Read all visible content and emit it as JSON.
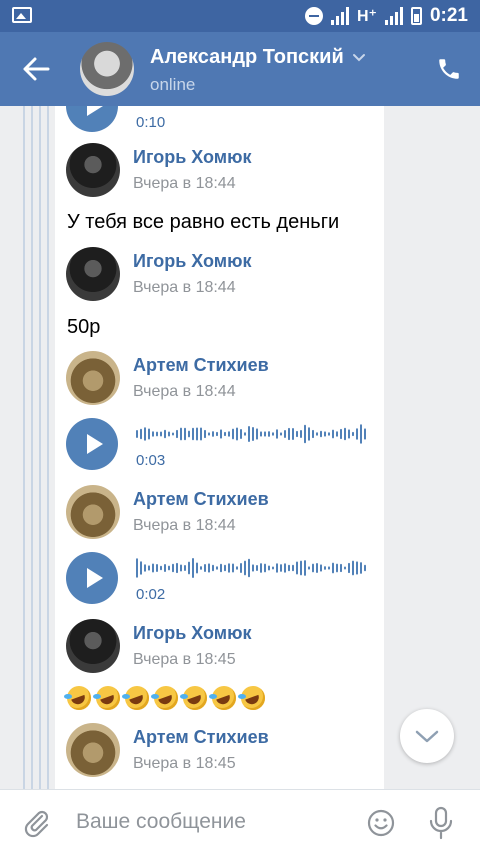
{
  "status_bar": {
    "network": "H⁺",
    "time": "0:21"
  },
  "header": {
    "title": "Александр Топский",
    "status": "online"
  },
  "messages": [
    {
      "type": "voice_partial",
      "duration": "0:10"
    },
    {
      "type": "author",
      "name": "Игорь Хомюк",
      "time": "Вчера в 18:44",
      "avatar": "dark"
    },
    {
      "type": "text",
      "text": "У тебя все равно есть деньги"
    },
    {
      "type": "author",
      "name": "Игорь Хомюк",
      "time": "Вчера в 18:44",
      "avatar": "dark"
    },
    {
      "type": "text",
      "text": "50р"
    },
    {
      "type": "author",
      "name": "Артем Стихиев",
      "time": "Вчера в 18:44",
      "avatar": "cat"
    },
    {
      "type": "voice",
      "duration": "0:03"
    },
    {
      "type": "author",
      "name": "Артем Стихиев",
      "time": "Вчера в 18:44",
      "avatar": "cat"
    },
    {
      "type": "voice",
      "duration": "0:02"
    },
    {
      "type": "author",
      "name": "Игорь Хомюк",
      "time": "Вчера в 18:45",
      "avatar": "dark"
    },
    {
      "type": "emoji",
      "count": 7,
      "emoji_name": "rolling-on-the-floor-laughing"
    },
    {
      "type": "author",
      "name": "Артем Стихиев",
      "time": "Вчера в 18:45",
      "avatar": "cat"
    }
  ],
  "composer": {
    "placeholder": "Ваше сообщение"
  },
  "colors": {
    "header": "#4f78b3",
    "statusbar": "#3e65a2",
    "accent": "#5181b8",
    "author": "#3d6ba4",
    "meta": "#909499"
  },
  "icons": [
    "gallery-icon",
    "back-arrow-icon",
    "chevron-down-icon",
    "phone-icon",
    "play-icon",
    "scroll-down-icon",
    "paperclip-icon",
    "smile-icon",
    "microphone-icon"
  ]
}
